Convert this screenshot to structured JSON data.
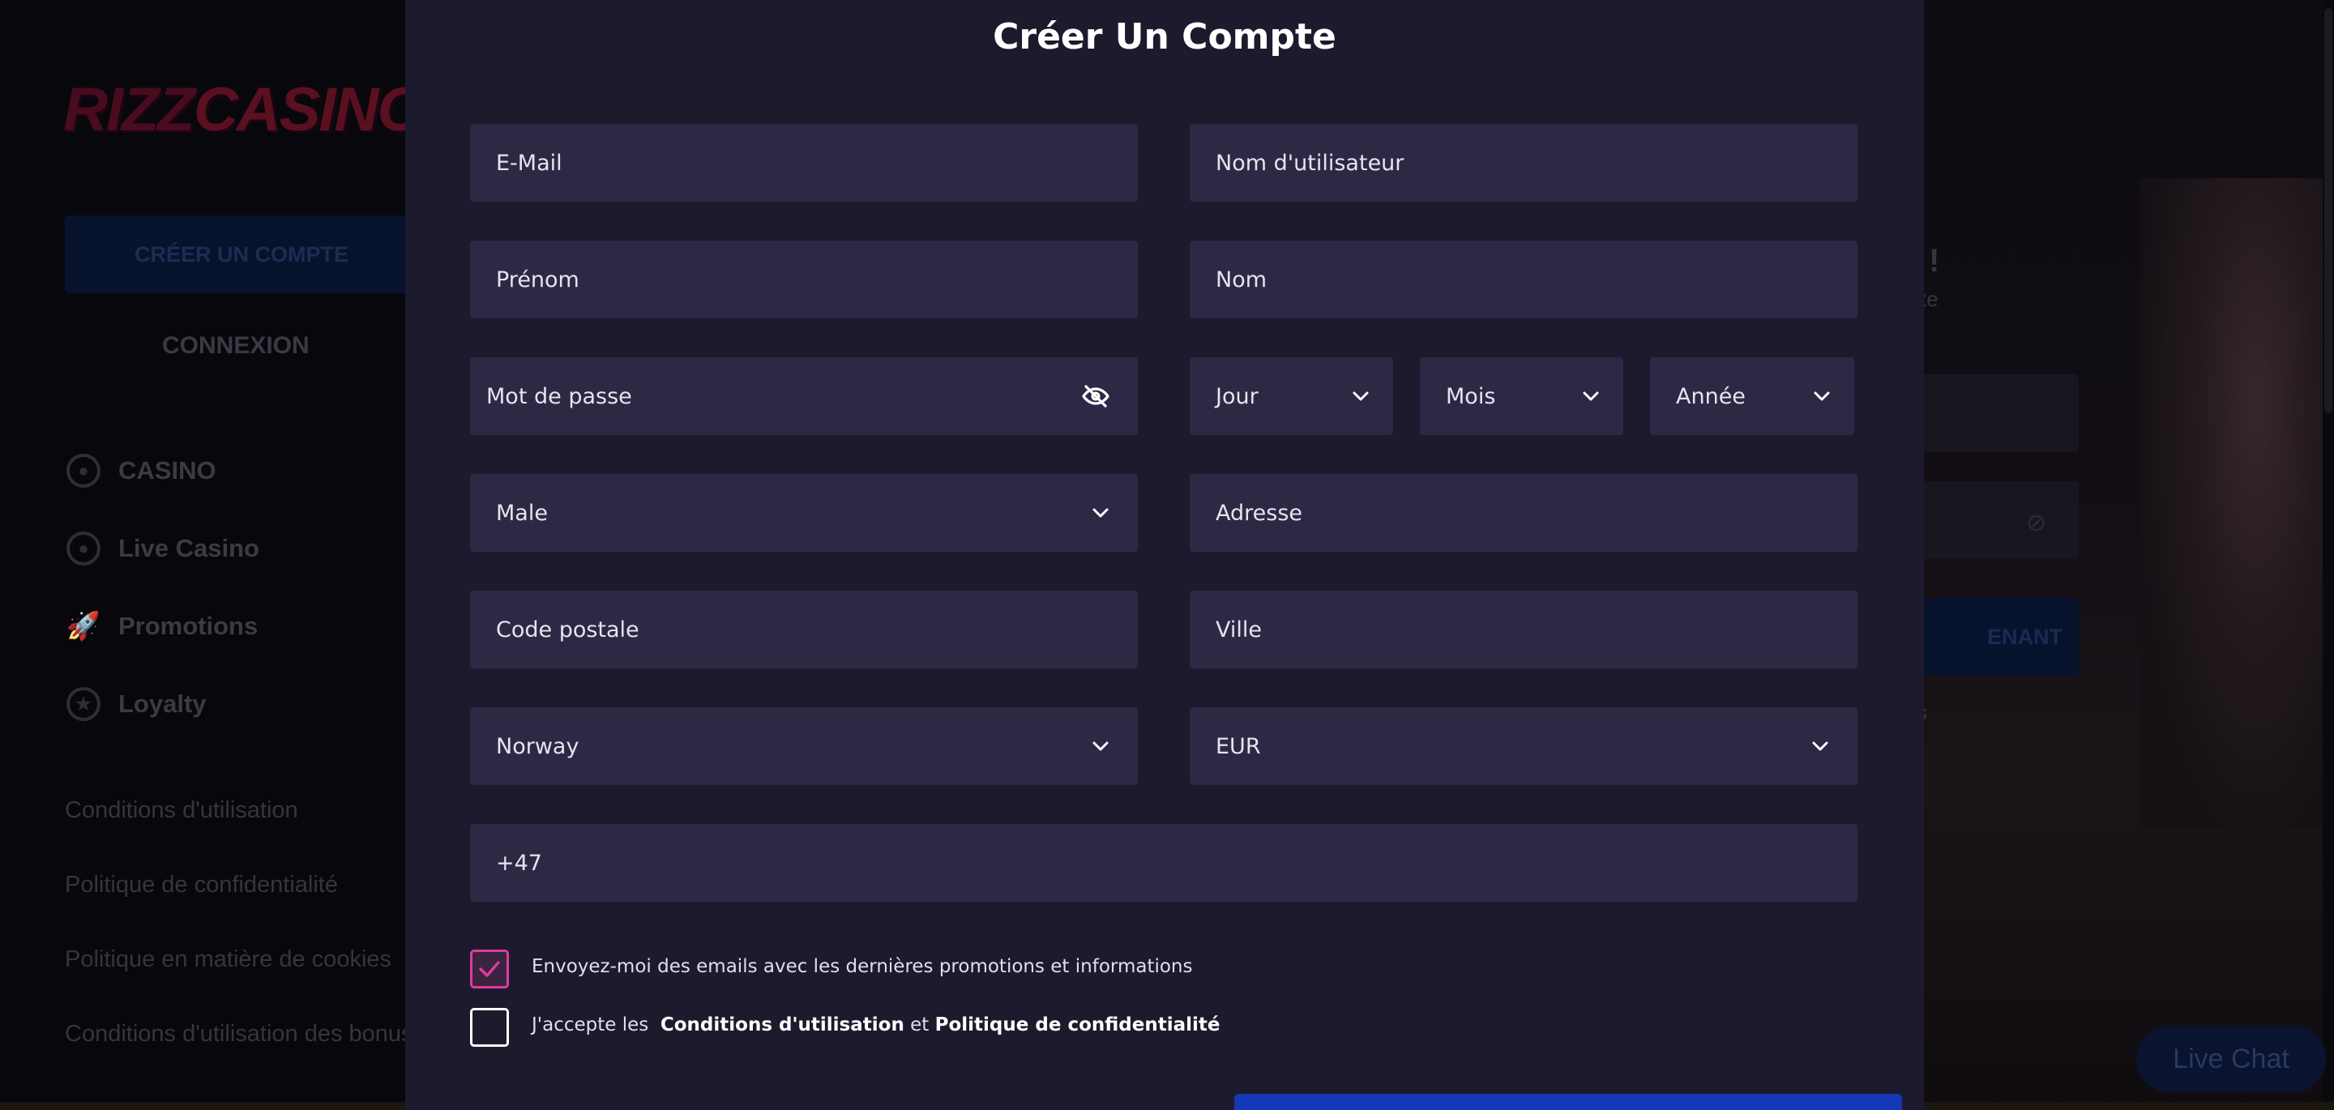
{
  "background": {
    "logo": {
      "part1": "RIZZ",
      "part2": "CASINO"
    },
    "create_account_label": "CRÉER UN COMPTE",
    "login_label": "CONNEXION",
    "nav": [
      {
        "label": "CASINO",
        "icon": "casino-chip-icon"
      },
      {
        "label": "Live Casino",
        "icon": "live-casino-icon"
      },
      {
        "label": "Promotions",
        "icon": "rocket-icon"
      },
      {
        "label": "Loyalty",
        "icon": "star-icon"
      }
    ],
    "links": [
      "Conditions d'utilisation",
      "Politique de confidentialité",
      "Politique en matière de cookies",
      "Conditions d'utilisation des bonus"
    ],
    "right_button_label": "ENANT",
    "right_text_1": "!",
    "right_text_2": "te",
    "right_text_3": "s",
    "live_chat_label": "Live Chat"
  },
  "modal": {
    "title": "Créer Un Compte",
    "fields": {
      "email": "E-Mail",
      "username": "Nom d'utilisateur",
      "first_name": "Prénom",
      "last_name": "Nom",
      "password": "Mot de passe",
      "day": "Jour",
      "month": "Mois",
      "year": "Année",
      "gender": "Male",
      "address": "Adresse",
      "postal_code": "Code postale",
      "city": "Ville",
      "country": "Norway",
      "currency": "EUR",
      "phone": "+47"
    },
    "checkboxes": {
      "promo": {
        "checked": true,
        "text": "Envoyez-moi des emails avec les dernières promotions et informations"
      },
      "terms": {
        "checked": false,
        "prefix": "J'accepte les",
        "terms_link": "Conditions d'utilisation",
        "conjunction": "et",
        "privacy_link": "Politique de confidentialité"
      }
    }
  },
  "colors": {
    "modal_bg": "#1c1a2d",
    "field_bg": "#2d2945",
    "checkbox_accent": "#e13aa3",
    "submit_button": "#1537b8"
  }
}
